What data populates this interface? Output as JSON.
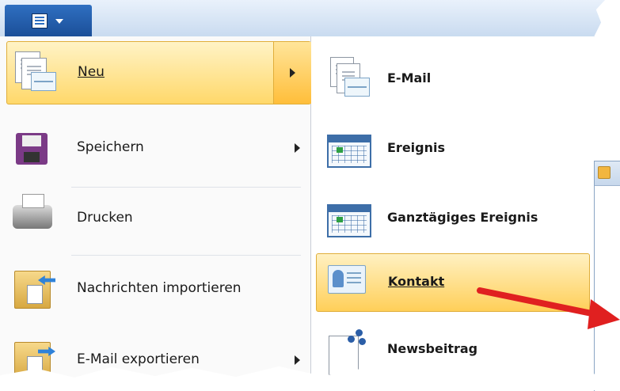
{
  "left_menu": [
    {
      "label": "Neu",
      "has_submenu": true,
      "highlighted": true
    },
    {
      "label": "Speichern",
      "has_submenu": true
    },
    {
      "label": "Drucken",
      "has_submenu": false
    },
    {
      "label": "Nachrichten importieren",
      "has_submenu": false
    },
    {
      "label": "E-Mail exportieren",
      "has_submenu": true
    }
  ],
  "submenu": [
    {
      "label": "E-Mail"
    },
    {
      "label": "Ereignis"
    },
    {
      "label": "Ganztägiges Ereignis"
    },
    {
      "label": "Kontakt",
      "highlighted": true
    },
    {
      "label": "Newsbeitrag"
    }
  ],
  "colors": {
    "annotation_arrow": "#e02020",
    "highlight": "#ffd86a",
    "titlebar_button": "#1f5aa8"
  }
}
